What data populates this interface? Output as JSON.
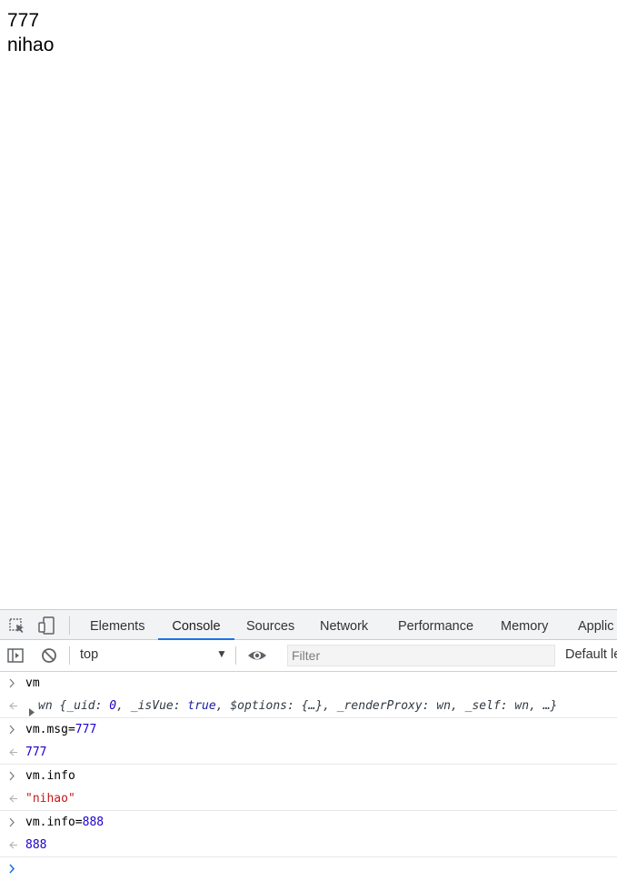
{
  "page": {
    "lines": [
      "777",
      "nihao"
    ]
  },
  "devtools": {
    "tabs": [
      "Elements",
      "Console",
      "Sources",
      "Network",
      "Performance",
      "Memory",
      "Applic"
    ],
    "active_tab": "Console",
    "context": "top",
    "filter_placeholder": "Filter",
    "levels": "Default le"
  },
  "console": {
    "e1": {
      "input": "vm",
      "obj_name": "wn",
      "obj_body_a": " {_uid: ",
      "uid": "0",
      "obj_body_b": ", _isVue: ",
      "isvue": "true",
      "obj_body_c": ", $options: {…}, _renderProxy: wn, _self: wn, …}"
    },
    "e2": {
      "input_a": "vm.msg=",
      "input_b": "777",
      "output": "777"
    },
    "e3": {
      "input": "vm.info",
      "output": "\"nihao\""
    },
    "e4": {
      "input_a": "vm.info=",
      "input_b": "888",
      "output": "888"
    }
  },
  "colors": {
    "accent": "#1a73e8",
    "number": "#1c00cf",
    "string": "#c41a16",
    "keyword": "#1a1aa6"
  }
}
